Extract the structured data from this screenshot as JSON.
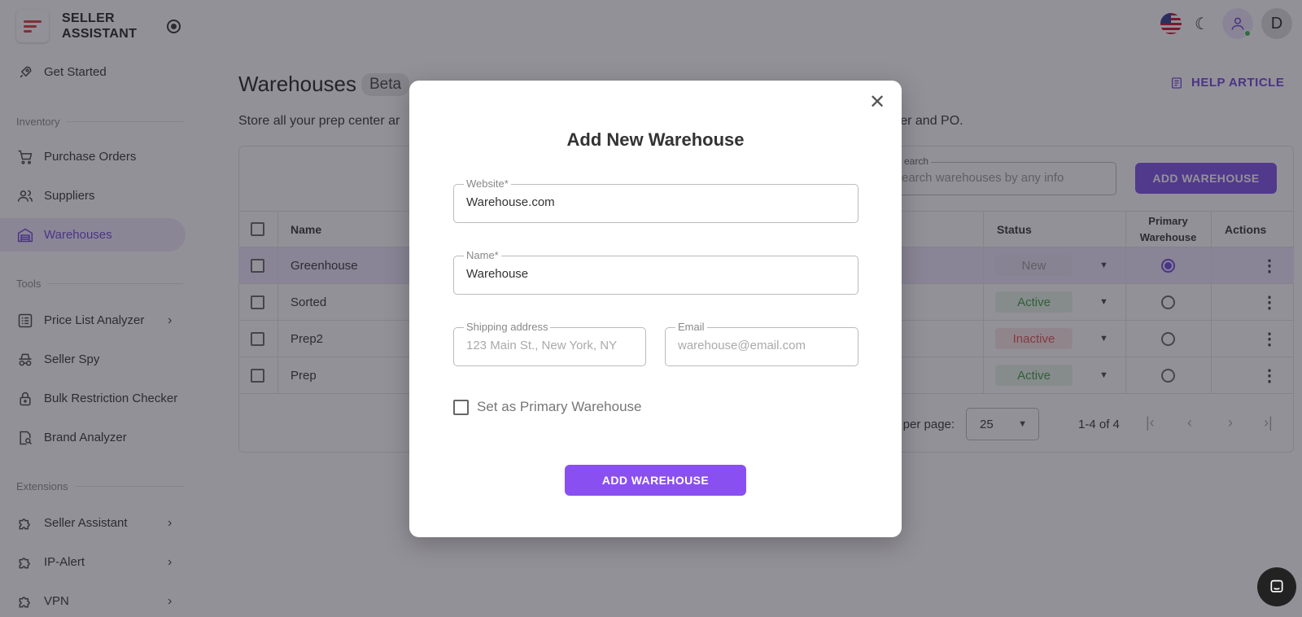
{
  "brand": {
    "line1": "SELLER",
    "line2": "ASSISTANT"
  },
  "sidebar": {
    "get_started": "Get Started",
    "sections": {
      "inventory": "Inventory",
      "tools": "Tools",
      "extensions": "Extensions"
    },
    "items": [
      {
        "label": "Purchase Orders",
        "icon": "cart-icon"
      },
      {
        "label": "Suppliers",
        "icon": "people-icon"
      },
      {
        "label": "Warehouses",
        "icon": "warehouse-icon"
      },
      {
        "label": "Price List Analyzer",
        "icon": "list-icon"
      },
      {
        "label": "Seller Spy",
        "icon": "spy-icon"
      },
      {
        "label": "Bulk Restriction Checker",
        "icon": "lock-icon"
      },
      {
        "label": "Brand Analyzer",
        "icon": "search-doc-icon"
      },
      {
        "label": "Seller Assistant",
        "icon": "puzzle-icon"
      },
      {
        "label": "IP-Alert",
        "icon": "puzzle-icon"
      },
      {
        "label": "VPN",
        "icon": "puzzle-icon"
      }
    ]
  },
  "header": {
    "avatar_letter": "D"
  },
  "page": {
    "title": "Warehouses",
    "badge": "Beta",
    "help": "HELP ARTICLE",
    "subtitle_left": "Store all your prep center ar",
    "subtitle_right": "pplier and PO.",
    "search_label": "earch",
    "search_placeholder": "earch warehouses by any info",
    "add_button": "ADD WAREHOUSE"
  },
  "table": {
    "columns": {
      "name": "Name",
      "status": "Status",
      "primary_line1": "Primary",
      "primary_line2": "Warehouse",
      "actions": "Actions"
    },
    "rows": [
      {
        "name": "Greenhouse",
        "status": "New",
        "primary": true
      },
      {
        "name": "Sorted",
        "status": "Active",
        "primary": false
      },
      {
        "name": "Prep2",
        "status": "Inactive",
        "primary": false
      },
      {
        "name": "Prep",
        "status": "Active",
        "primary": false
      }
    ],
    "rows_per_page_label": "s per page:",
    "rows_per_page": "25",
    "range": "1-4 of 4"
  },
  "modal": {
    "title": "Add New Warehouse",
    "website_label": "Website*",
    "website_value": "Warehouse.com",
    "name_label": "Name*",
    "name_value": "Warehouse",
    "shipping_label": "Shipping address",
    "shipping_placeholder": "123 Main St., New York, NY",
    "email_label": "Email",
    "email_placeholder": "warehouse@email.com",
    "primary_checkbox": "Set as Primary Warehouse",
    "submit": "ADD WAREHOUSE"
  },
  "colors": {
    "accent": "#7b4ee6",
    "active_nav_bg": "#ece8fa"
  }
}
